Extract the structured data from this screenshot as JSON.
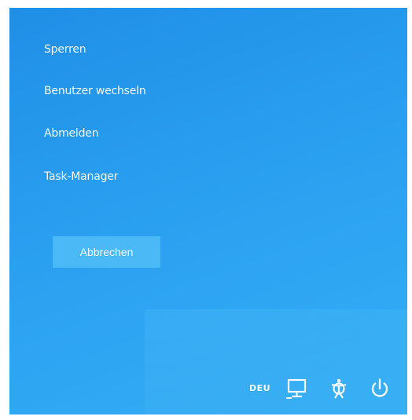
{
  "menu": {
    "items": [
      {
        "label": "Sperren"
      },
      {
        "label": "Benutzer wechseln"
      },
      {
        "label": "Abmelden"
      },
      {
        "label": "Task-Manager"
      }
    ]
  },
  "cancel_button": {
    "label": "Abbrechen"
  },
  "tray": {
    "language": "DEU",
    "icons": [
      "network-icon",
      "ease-of-access-icon",
      "power-icon"
    ]
  },
  "colors": {
    "background": "#2a9ff0",
    "text": "#f4faff",
    "button": "#4ab9f5"
  }
}
